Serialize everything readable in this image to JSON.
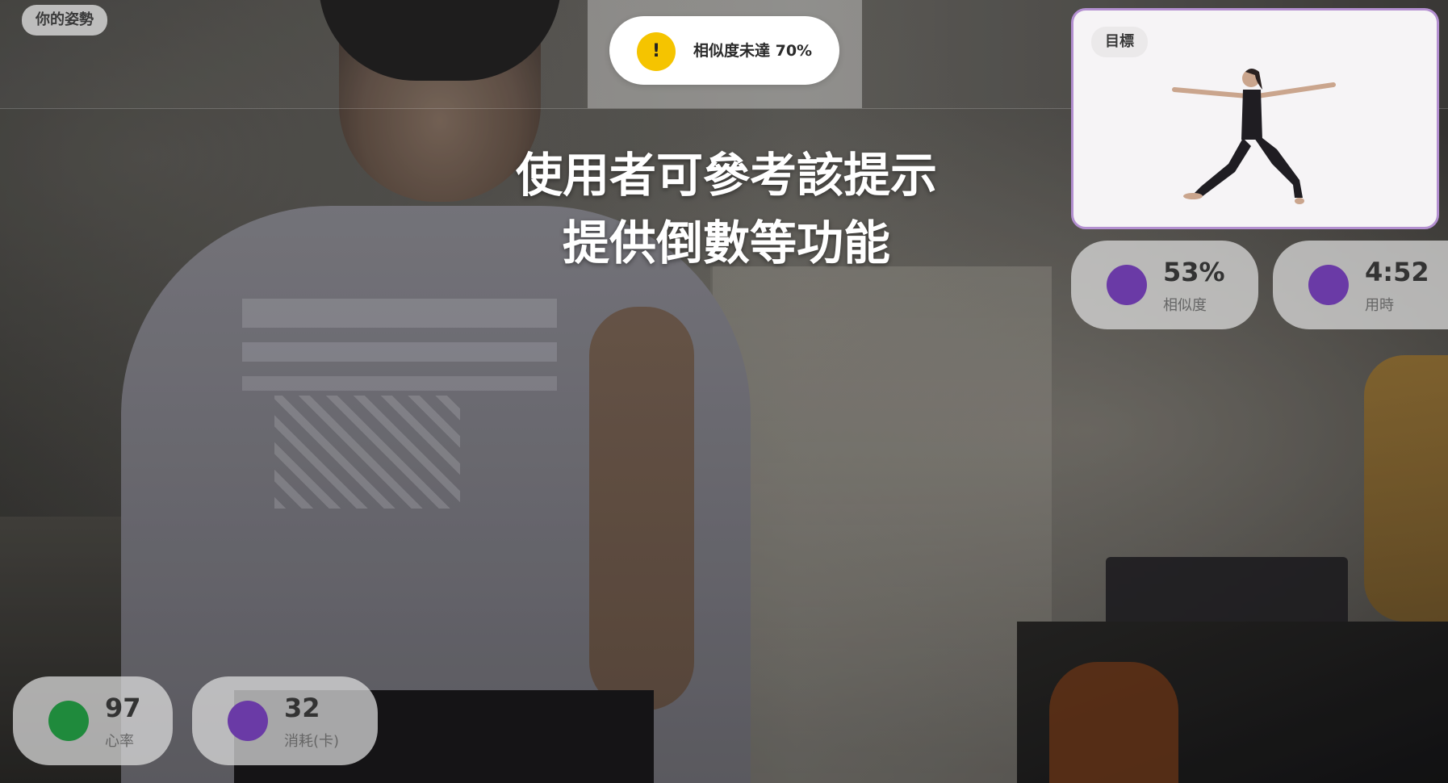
{
  "pose_label": "你的姿勢",
  "alert": {
    "icon": "!",
    "text": "相似度未達 70%",
    "icon_color": "#f5c400"
  },
  "caption": {
    "line1": "使用者可參考該提示",
    "line2": "提供倒數等功能"
  },
  "target": {
    "label": "目標",
    "border_color": "#b38fd0"
  },
  "stats": {
    "similarity": {
      "value": "53%",
      "label": "相似度",
      "dot_color": "#6a3aa6"
    },
    "time": {
      "value": "4:52",
      "label": "用時",
      "dot_color": "#6a3aa6"
    },
    "heart_rate": {
      "value": "97",
      "label": "心率",
      "dot_color": "#1f8a3c"
    },
    "calories": {
      "value": "32",
      "label": "消耗(卡)",
      "dot_color": "#6a3aa6"
    }
  }
}
